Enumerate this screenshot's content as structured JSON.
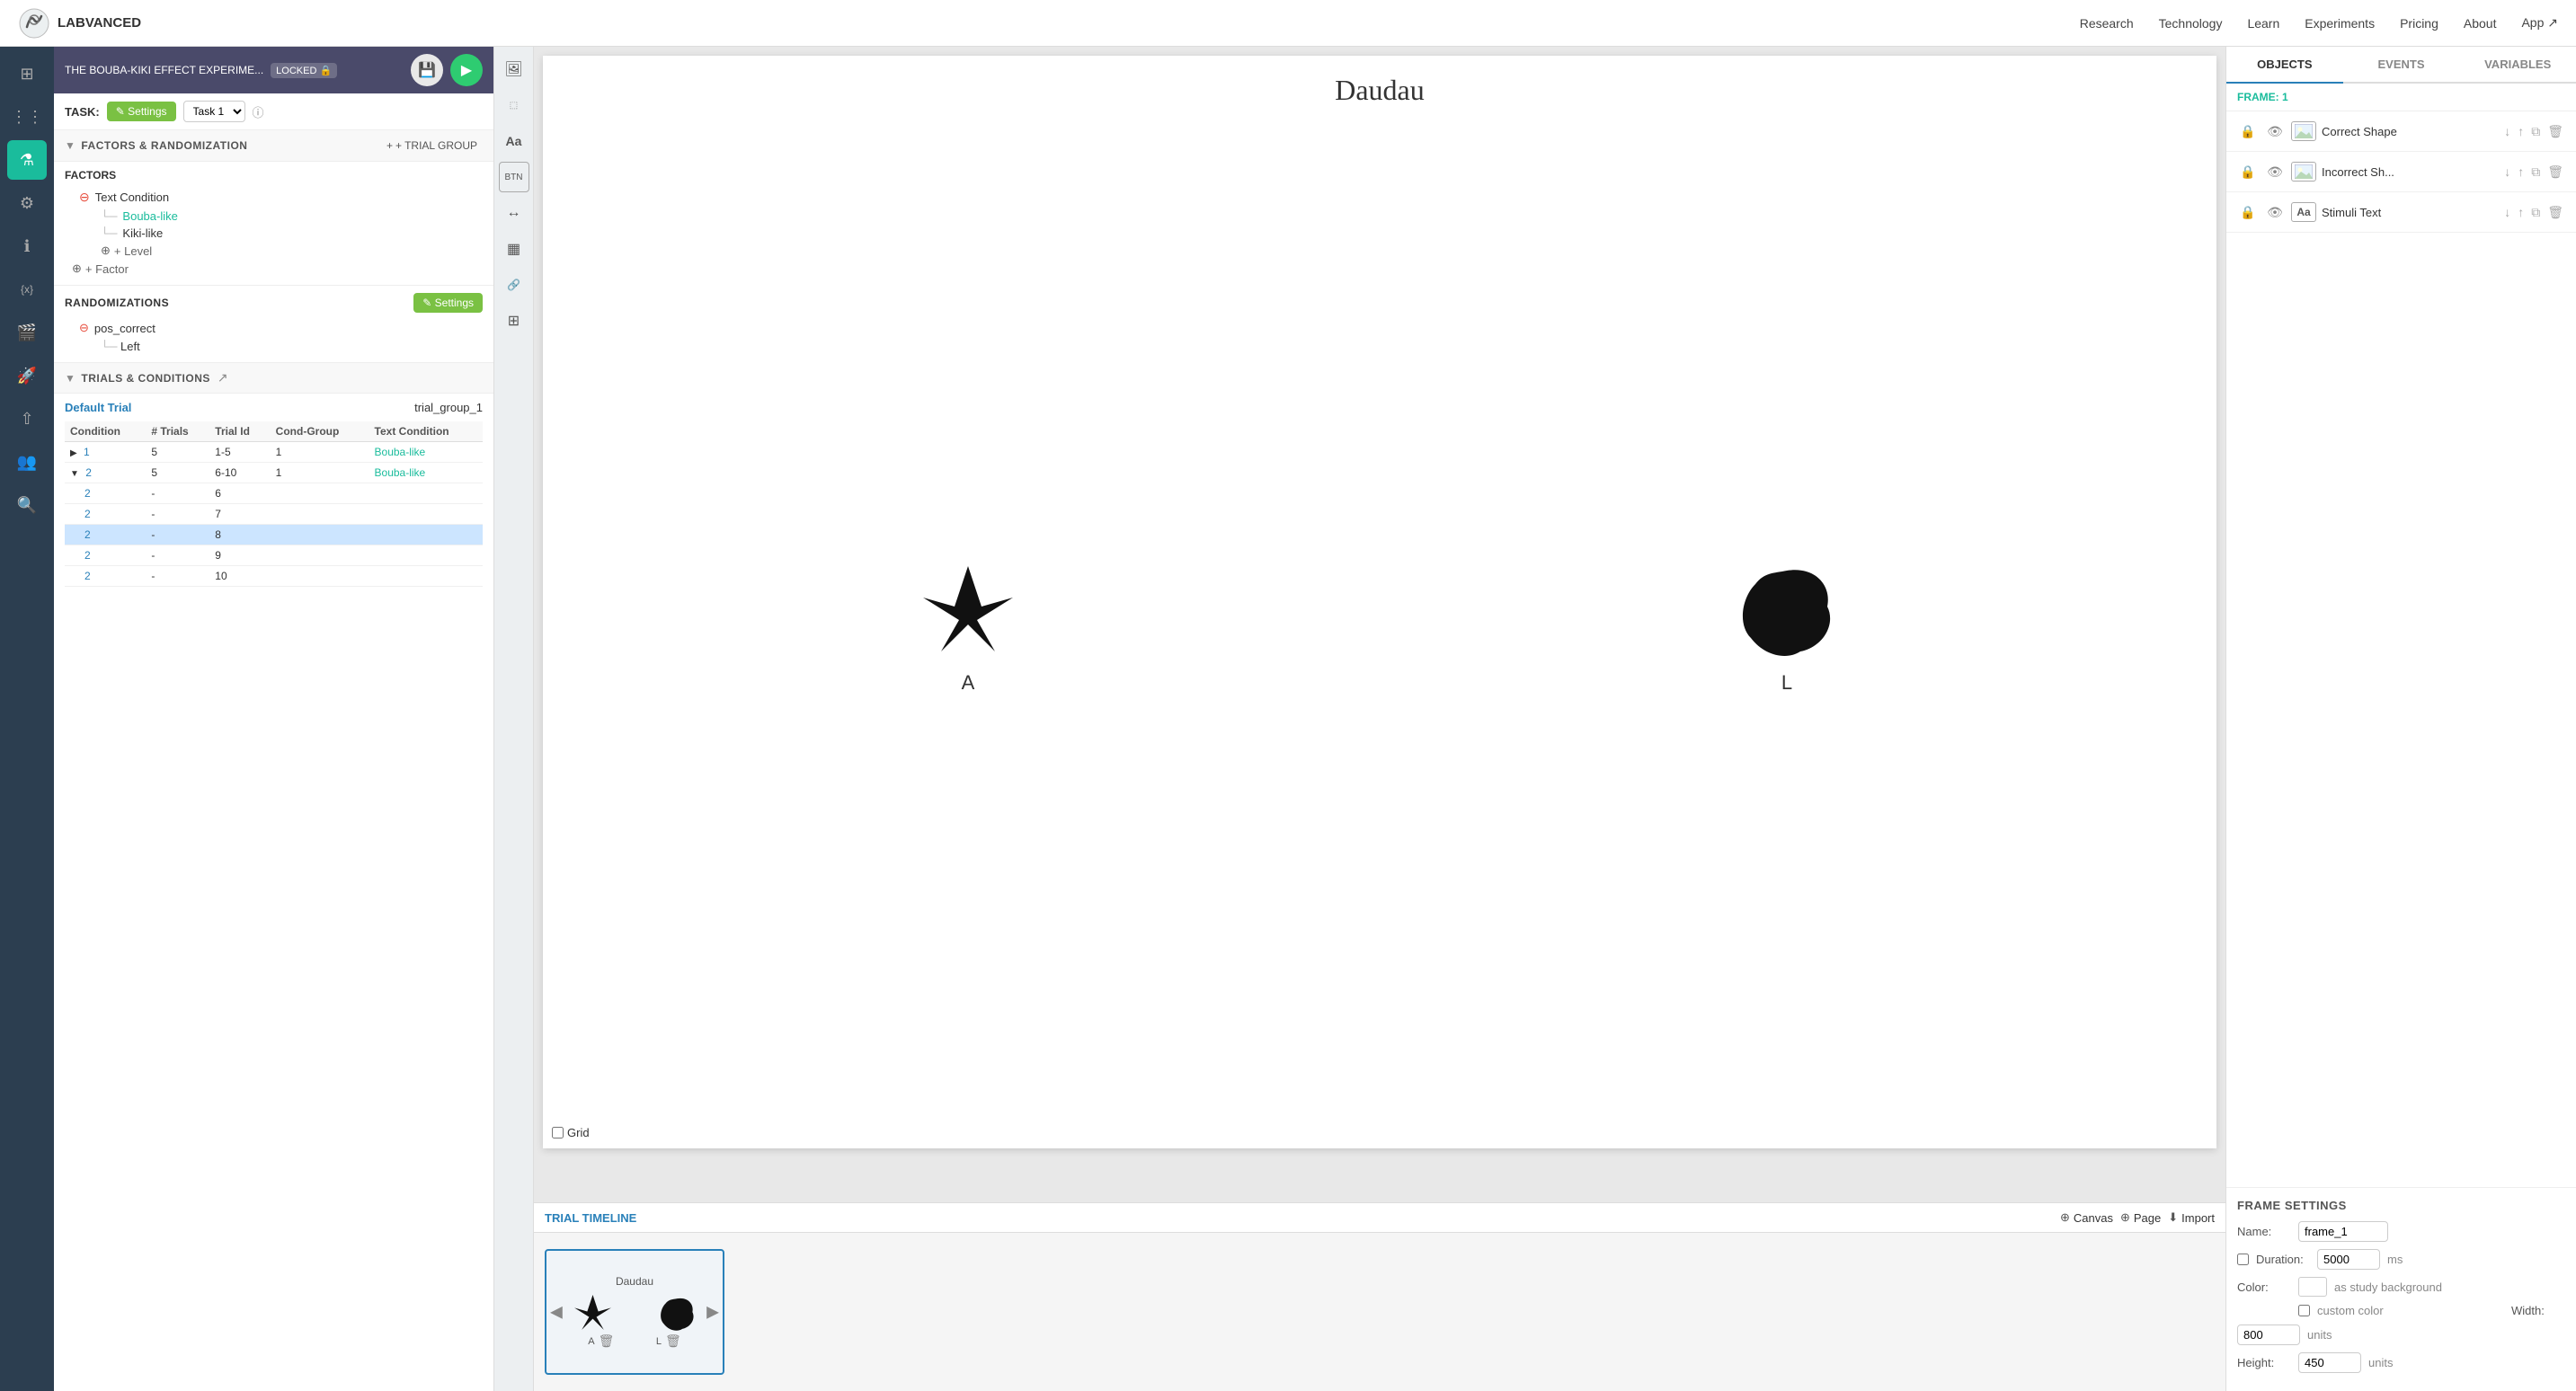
{
  "nav": {
    "logo_text": "LABVANCED",
    "links": [
      "Research",
      "Technology",
      "Learn",
      "Experiments",
      "Pricing",
      "About",
      "App ↗"
    ]
  },
  "left_sidebar": {
    "icons": [
      {
        "name": "grid-icon",
        "symbol": "⊞",
        "active": false
      },
      {
        "name": "hierarchy-icon",
        "symbol": "⋮",
        "active": false
      },
      {
        "name": "experiment-icon",
        "symbol": "⚗",
        "active": true
      },
      {
        "name": "settings-icon",
        "symbol": "⚙",
        "active": false
      },
      {
        "name": "info-icon",
        "symbol": "ℹ",
        "active": false
      },
      {
        "name": "variable-icon",
        "symbol": "{x}",
        "active": false
      },
      {
        "name": "media-icon",
        "symbol": "🎬",
        "active": false
      },
      {
        "name": "rocket-icon",
        "symbol": "🚀",
        "active": false
      },
      {
        "name": "share-icon",
        "symbol": "⇧",
        "active": false
      },
      {
        "name": "users-icon",
        "symbol": "👥",
        "active": false
      },
      {
        "name": "search-icon",
        "symbol": "🔍",
        "active": false
      }
    ]
  },
  "panel_header": {
    "title": "THE BOUBA-KIKI EFFECT EXPERIME...",
    "locked_label": "LOCKED",
    "lock_icon": "🔒"
  },
  "task_bar": {
    "task_label": "TASK:",
    "settings_label": "✎ Settings",
    "task_name": "Task 1",
    "info_symbol": "ⓘ"
  },
  "factors_section": {
    "title": "FACTORS & RANDOMIZATION",
    "add_trial_group_label": "+ TRIAL GROUP",
    "factors_label": "FACTORS",
    "factor_name": "Text Condition",
    "levels": [
      "Bouba-like",
      "Kiki-like"
    ],
    "active_level": "Bouba-like",
    "add_level_label": "+ Level",
    "add_factor_label": "+ Factor",
    "randomizations_label": "RANDOMIZATIONS",
    "randomizations_settings_label": "✎ Settings",
    "rand_name": "pos_correct",
    "rand_child": "Left"
  },
  "trials_section": {
    "title": "TRIALS & CONDITIONS",
    "default_trial_label": "Default Trial",
    "trial_group_label": "trial_group_1",
    "columns": [
      "Condition",
      "# Trials",
      "Trial Id",
      "Cond-Group",
      "Text Condition"
    ],
    "rows": [
      {
        "expand": "▶",
        "condition": "1",
        "trials": "5",
        "trial_id": "1-5",
        "cond_group": "1",
        "text_condition": "Bouba-like",
        "selected": false
      },
      {
        "expand": "▼",
        "condition": "2",
        "trials": "5",
        "trial_id": "6-10",
        "cond_group": "1",
        "text_condition": "Bouba-like",
        "selected": false
      },
      {
        "expand": "",
        "condition": "2",
        "trials": "-",
        "trial_id": "6",
        "cond_group": "",
        "text_condition": "",
        "selected": false
      },
      {
        "expand": "",
        "condition": "2",
        "trials": "-",
        "trial_id": "7",
        "cond_group": "",
        "text_condition": "",
        "selected": false
      },
      {
        "expand": "",
        "condition": "2",
        "trials": "-",
        "trial_id": "8",
        "cond_group": "",
        "text_condition": "",
        "selected": true
      },
      {
        "expand": "",
        "condition": "2",
        "trials": "-",
        "trial_id": "9",
        "cond_group": "",
        "text_condition": "",
        "selected": false
      },
      {
        "expand": "",
        "condition": "2",
        "trials": "-",
        "trial_id": "10",
        "cond_group": "",
        "text_condition": "",
        "selected": false
      }
    ]
  },
  "canvas": {
    "title": "Daudau",
    "shape_a_label": "A",
    "shape_l_label": "L",
    "grid_label": "Grid",
    "grid_checked": false
  },
  "canvas_toolbar": {
    "tools": [
      {
        "name": "image-tool",
        "symbol": "🖼"
      },
      {
        "name": "dotted-tool",
        "symbol": "⋯"
      },
      {
        "name": "text-tool",
        "symbol": "Aa"
      },
      {
        "name": "button-tool",
        "symbol": "⬜"
      },
      {
        "name": "arrow-tool",
        "symbol": "↔"
      },
      {
        "name": "layout-tool",
        "symbol": "▦"
      },
      {
        "name": "link-tool",
        "symbol": "🔗"
      },
      {
        "name": "grid-tool",
        "symbol": "⊞"
      }
    ]
  },
  "timeline": {
    "title": "TRIAL TIMELINE",
    "add_canvas_label": "Canvas",
    "add_page_label": "Page",
    "import_label": "Import",
    "frame_name": "Daudau",
    "nav_left": "◀",
    "nav_right": "▶",
    "bottom_items": [
      {
        "label": "A",
        "icon": "trash"
      },
      {
        "label": "L",
        "icon": "trash"
      }
    ]
  },
  "right_panel": {
    "tabs": [
      "OBJECTS",
      "EVENTS",
      "VARIABLES"
    ],
    "active_tab": "OBJECTS",
    "frame_label": "FRAME: 1",
    "objects": [
      {
        "lock": true,
        "visible": true,
        "type": "image",
        "name": "Correct Shape"
      },
      {
        "lock": true,
        "visible": true,
        "type": "image",
        "name": "Incorrect Sh..."
      },
      {
        "lock": true,
        "visible": true,
        "type": "text",
        "name": "Stimuli Text"
      }
    ]
  },
  "frame_settings": {
    "title": "FRAME SETTINGS",
    "name_label": "Name:",
    "name_value": "frame_1",
    "duration_label": "Duration:",
    "duration_value": "5000",
    "duration_unit": "ms",
    "color_label": "Color:",
    "color_suffix": "as study background",
    "custom_color_label": "custom color",
    "width_label": "Width:",
    "width_value": "800",
    "width_unit": "units",
    "height_label": "Height:",
    "height_value": "450",
    "height_unit": "units"
  }
}
